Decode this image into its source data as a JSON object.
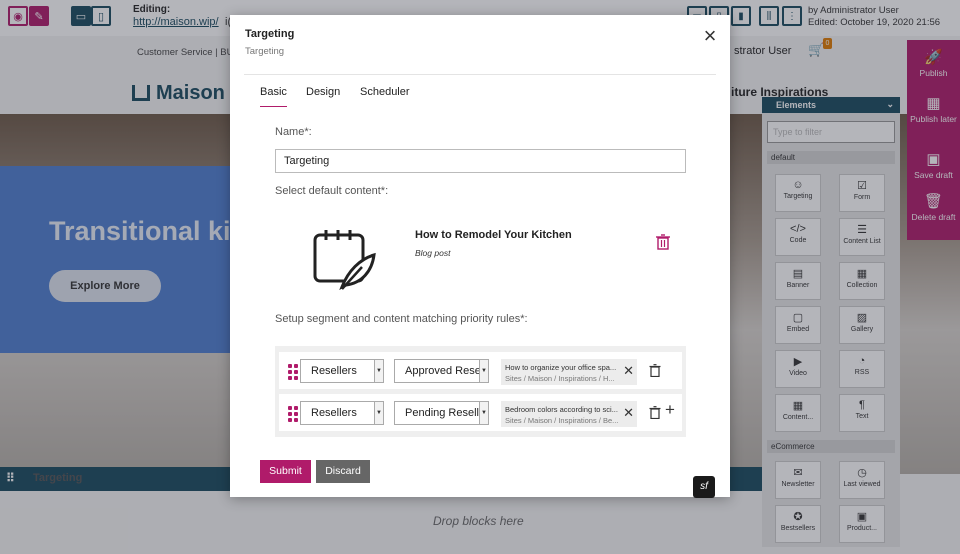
{
  "editor": {
    "editing_label": "Editing:",
    "url": "http://maison.wip/",
    "url_suffix": "i(",
    "author_line": "by Administrator User",
    "edited_line": "Edited: October 19, 2020 21:56"
  },
  "site": {
    "nav_left": "Customer Service  |  BU",
    "nav_right": "strator User",
    "logo": "Maison",
    "menu_right": "iture    Inspirations",
    "hero_title": "Transitional kit",
    "hero_button": "Explore More",
    "block_bar": "Targeting",
    "drop_text": "Drop blocks here"
  },
  "publish_panel": {
    "publish": "Publish",
    "publish_later": "Publish later",
    "save_draft": "Save draft",
    "delete_draft": "Delete draft"
  },
  "elements_panel": {
    "title": "Elements",
    "search_placeholder": "Type to filter",
    "cat_default": "default",
    "cat_ecommerce": "eCommerce",
    "tiles": [
      "Targeting",
      "Form",
      "Code",
      "Content List",
      "Banner",
      "Collection",
      "Embed",
      "Gallery",
      "Video",
      "RSS",
      "Content...",
      "Text"
    ],
    "ecom_tiles": [
      "Newsletter",
      "Last viewed",
      "Bestsellers",
      "Product..."
    ]
  },
  "modal": {
    "title": "Targeting",
    "subtitle": "Targeting",
    "tabs": [
      "Basic",
      "Design",
      "Scheduler"
    ],
    "name_label": "Name*:",
    "name_value": "Targeting",
    "default_label": "Select default content*:",
    "content_title": "How to Remodel Your Kitchen",
    "content_type": "Blog post",
    "rules_label": "Setup segment and content matching priority rules*:",
    "rules": [
      {
        "segment": "Resellers",
        "priority": "Approved Resel",
        "content_title": "How to organize your office spa...",
        "content_path": "Sites / Maison / Inspirations / H..."
      },
      {
        "segment": "Resellers",
        "priority": "Pending Reselle",
        "content_title": "Bedroom colors according to sci...",
        "content_path": "Sites / Maison / Inspirations / Be..."
      }
    ],
    "submit": "Submit",
    "discard": "Discard",
    "badge": "sf"
  },
  "colors": {
    "accent": "#b01b6a",
    "dark_teal": "#1a4a5f"
  }
}
